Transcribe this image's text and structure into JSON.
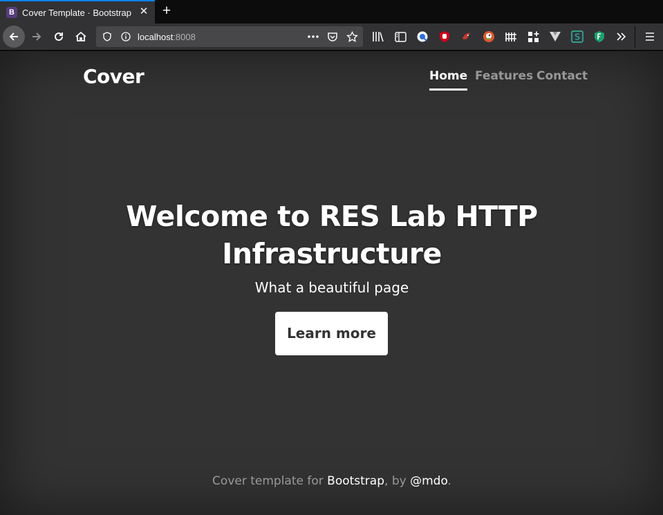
{
  "browser": {
    "tab_title": "Cover Template · Bootstrap",
    "favicon_letter": "B",
    "url_host": "localhost",
    "url_port": ":8008",
    "accent": "#0a84ff"
  },
  "page": {
    "brand": "Cover",
    "nav": [
      "Home",
      "Features",
      "Contact"
    ],
    "active_nav": "Home",
    "heading_line1": "Welcome to RES Lab HTTP",
    "heading_line2": "Infrastructure",
    "lead": "What a beautiful page",
    "button": "Learn more",
    "footer": {
      "prefix": "Cover template for ",
      "link1": "Bootstrap",
      "middle": ", by ",
      "link2": "@mdo",
      "suffix": "."
    },
    "background": "#333333"
  }
}
